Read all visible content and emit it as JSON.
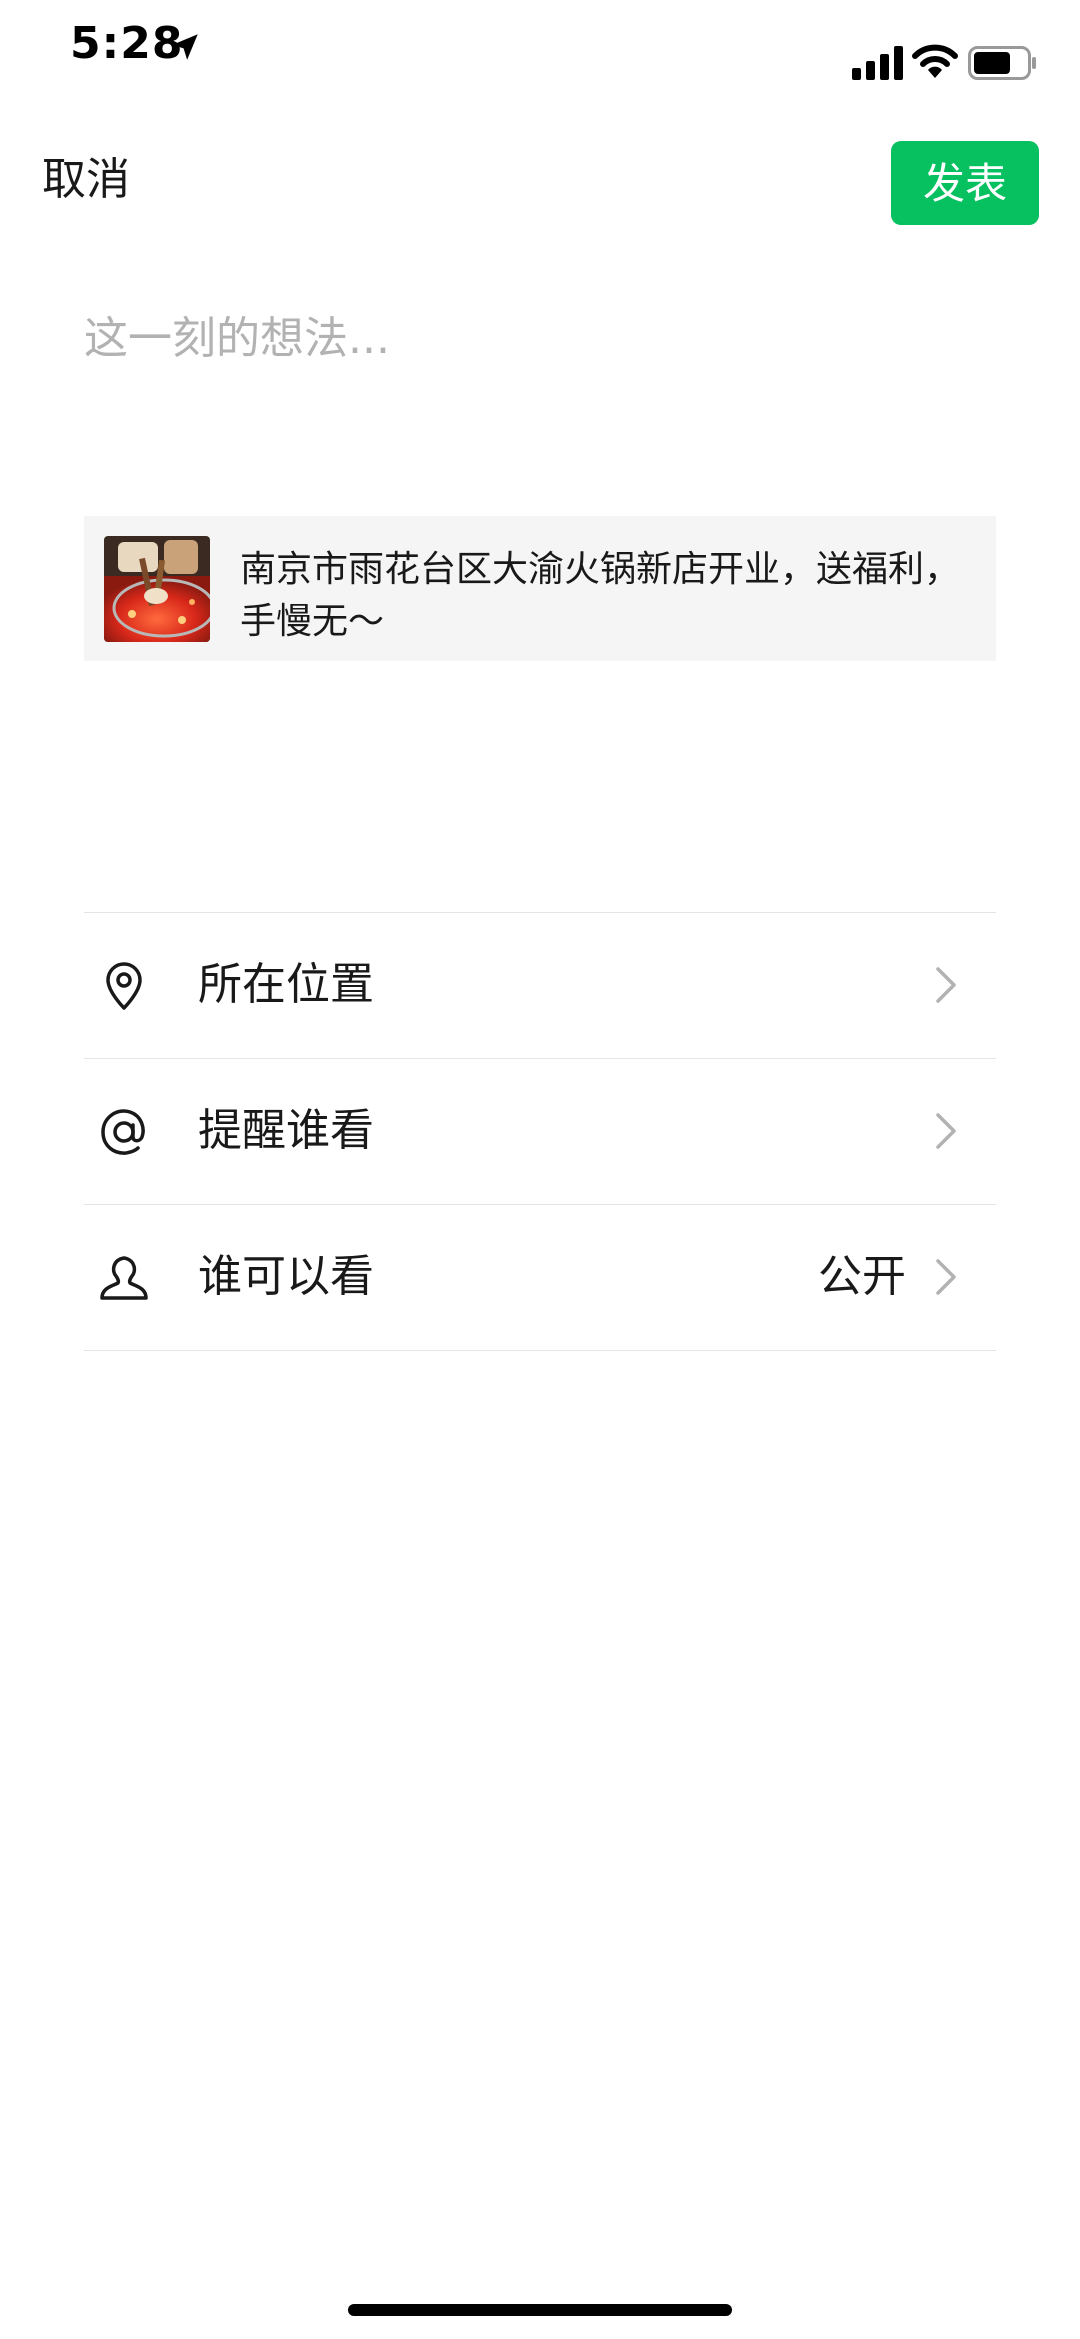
{
  "status_bar": {
    "time": "5:28",
    "location_icon": "location-arrow-icon",
    "signal_icon": "cellular-signal-icon",
    "wifi_icon": "wifi-icon",
    "battery_icon": "battery-icon"
  },
  "header": {
    "cancel_label": "取消",
    "publish_label": "发表"
  },
  "composer": {
    "placeholder": "这一刻的想法...",
    "value": ""
  },
  "link_card": {
    "thumbnail_icon": "hotpot-thumbnail",
    "title": "南京市雨花台区大渝火锅新店开业，送福利，手慢无～"
  },
  "options": [
    {
      "icon": "location-pin-icon",
      "label": "所在位置",
      "value": ""
    },
    {
      "icon": "at-sign-icon",
      "label": "提醒谁看",
      "value": ""
    },
    {
      "icon": "person-icon",
      "label": "谁可以看",
      "value": "公开"
    }
  ],
  "colors": {
    "accent": "#07c160",
    "text": "#191919",
    "placeholder": "#b2b2b2",
    "card_bg": "#f5f5f5",
    "divider": "#e5e5e5"
  }
}
